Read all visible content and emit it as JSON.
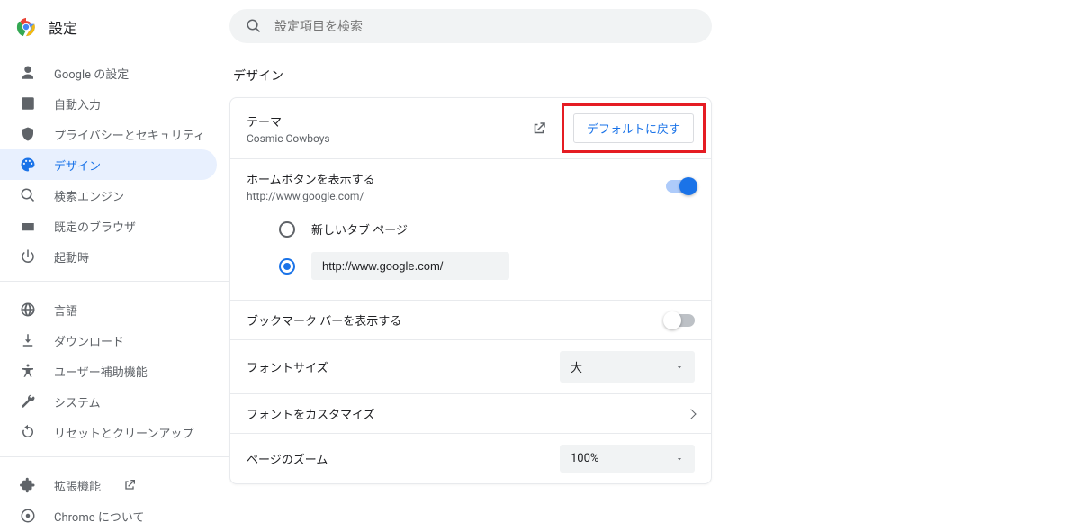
{
  "header": {
    "title": "設定"
  },
  "search": {
    "placeholder": "設定項目を検索"
  },
  "sidebar": {
    "items": [
      {
        "label": "Google の設定"
      },
      {
        "label": "自動入力"
      },
      {
        "label": "プライバシーとセキュリティ"
      },
      {
        "label": "デザイン"
      },
      {
        "label": "検索エンジン"
      },
      {
        "label": "既定のブラウザ"
      },
      {
        "label": "起動時"
      }
    ],
    "items2": [
      {
        "label": "言語"
      },
      {
        "label": "ダウンロード"
      },
      {
        "label": "ユーザー補助機能"
      },
      {
        "label": "システム"
      },
      {
        "label": "リセットとクリーンアップ"
      }
    ],
    "items3": [
      {
        "label": "拡張機能"
      },
      {
        "label": "Chrome について"
      }
    ]
  },
  "section": {
    "title": "デザイン"
  },
  "theme": {
    "label": "テーマ",
    "value": "Cosmic Cowboys",
    "reset_button": "デフォルトに戻す"
  },
  "home_button": {
    "label": "ホームボタンを表示する",
    "sub": "http://www.google.com/",
    "enabled": true,
    "options": {
      "new_tab": "新しいタブ ページ",
      "custom_url": "http://www.google.com/"
    }
  },
  "bookmark_bar": {
    "label": "ブックマーク バーを表示する",
    "enabled": false
  },
  "font_size": {
    "label": "フォントサイズ",
    "value": "大"
  },
  "font_customize": {
    "label": "フォントをカスタマイズ"
  },
  "page_zoom": {
    "label": "ページのズーム",
    "value": "100%"
  }
}
